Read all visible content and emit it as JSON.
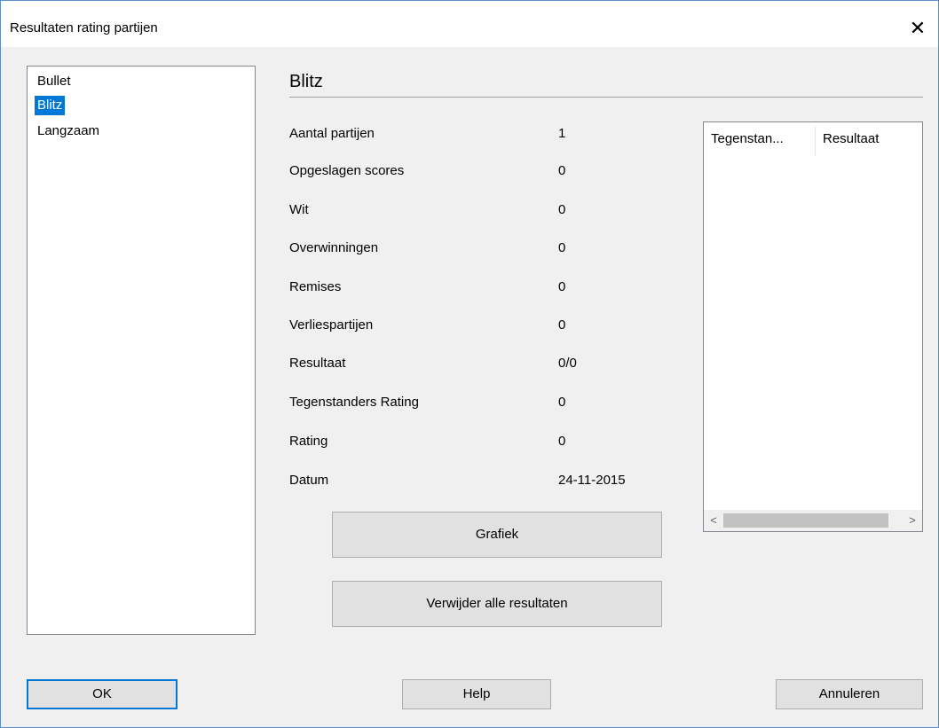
{
  "window": {
    "title": "Resultaten rating partijen",
    "close_glyph": "✕"
  },
  "categories": {
    "items": [
      "Bullet",
      "Blitz",
      "Langzaam"
    ],
    "selected": "Blitz"
  },
  "section": {
    "title": "Blitz"
  },
  "stats": [
    {
      "label": "Aantal partijen",
      "value": "1"
    },
    {
      "label": "Opgeslagen scores",
      "value": "0"
    },
    {
      "label": "Wit",
      "value": "0"
    },
    {
      "label": "Overwinningen",
      "value": "0"
    },
    {
      "label": "Remises",
      "value": "0"
    },
    {
      "label": "Verliespartijen",
      "value": "0"
    },
    {
      "label": "Resultaat",
      "value": "0/0"
    },
    {
      "label": "Tegenstanders Rating",
      "value": "0"
    },
    {
      "label": "Rating",
      "value": "0"
    },
    {
      "label": "Datum",
      "value": "24-11-2015"
    }
  ],
  "actions": {
    "graph_label": "Grafiek",
    "delete_all_label": "Verwijder alle resultaten"
  },
  "results_table": {
    "columns": [
      "Tegenstan...",
      "Resultaat"
    ],
    "scroll_left": "<",
    "scroll_right": ">"
  },
  "footer": {
    "ok_label": "OK",
    "help_label": "Help",
    "cancel_label": "Annuleren"
  },
  "colors": {
    "accent": "#0078d7",
    "window_border": "#5a8fcf",
    "dialog_bg": "#f0f0f0"
  }
}
